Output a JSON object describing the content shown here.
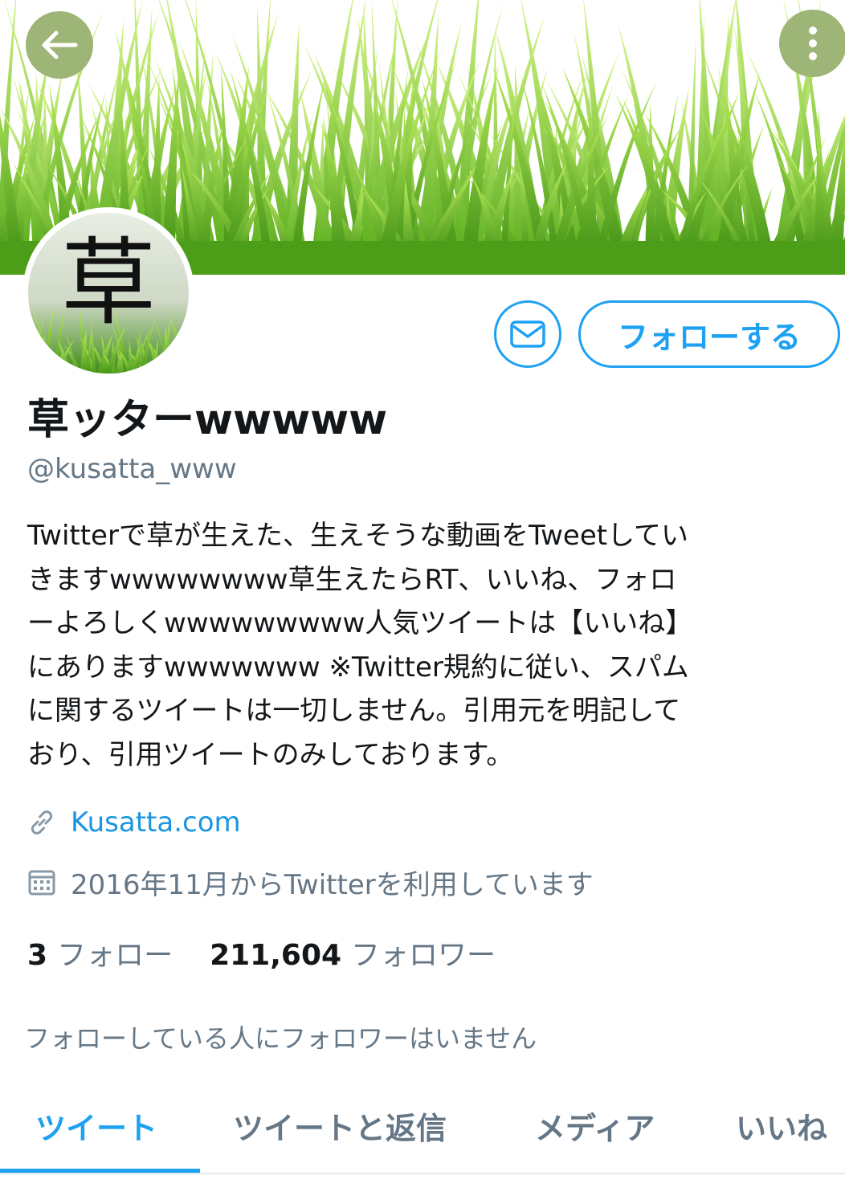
{
  "header": {
    "back_icon": "arrow-left-icon",
    "more_icon": "vertical-dots-icon",
    "button_bg": "#9db576"
  },
  "profile": {
    "avatar_text": "草",
    "display_name": "草ッターwwwww",
    "handle": "@kusatta_www",
    "bio_lines": [
      "Twitterで草が生えた、生えそうな動画をTweetしてい",
      "きますwwwwwwww草生えたらRT、いいね、フォロ",
      "ーよろしくwwwwwwwww人気ツイートは【いいね】",
      "にありますwwwwwww ※Twitter規約に従い、スパム",
      "に関するツイートは一切しません。引用元を明記して",
      "おり、引用ツイートのみしております。"
    ],
    "website": "Kusatta.com",
    "joined": "2016年11月からTwitterを利用しています",
    "following_count": "3",
    "following_label": "フォロー",
    "followers_count": "211,604",
    "followers_label": "フォロワー",
    "followers_you_know": "フォローしている人にフォロワーはいません"
  },
  "actions": {
    "follow_label": "フォローする",
    "message_icon": "envelope-icon"
  },
  "tabs": [
    {
      "label": "ツイート",
      "active": true
    },
    {
      "label": "ツイートと返信",
      "active": false
    },
    {
      "label": "メディア",
      "active": false
    },
    {
      "label": "いいね",
      "active": false
    }
  ],
  "colors": {
    "accent": "#1da1f2",
    "link": "#1b95e0",
    "secondary_text": "#657786",
    "grass": "#6cc21c"
  }
}
